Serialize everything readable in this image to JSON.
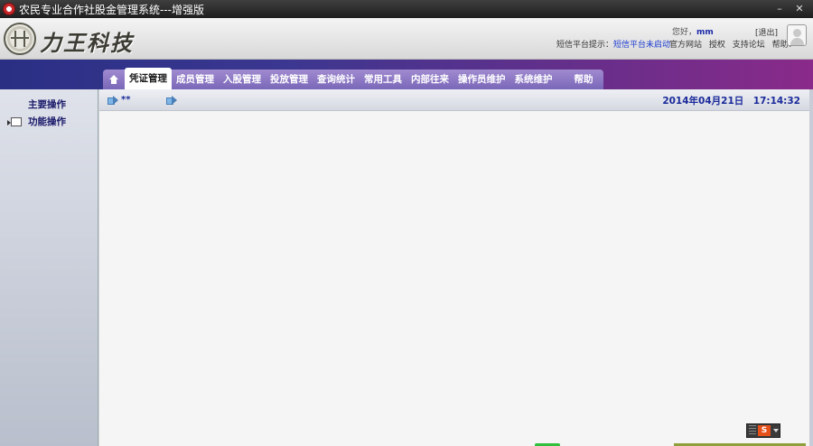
{
  "window": {
    "title": "农民专业合作社股金管理系统---增强版",
    "controls": {
      "minimize": "–",
      "close": "✕"
    }
  },
  "header": {
    "brand": "力王科技",
    "greeting_prefix": "您好，",
    "username": "mm",
    "logout": "[退出]",
    "sms_label": "短信平台提示：",
    "sms_status": "短信平台未启动",
    "links": [
      "官方网站",
      "授权",
      "支持论坛",
      "帮助?"
    ]
  },
  "nav": {
    "home_icon": "home-icon",
    "items": [
      {
        "label": "凭证管理",
        "active": true
      },
      {
        "label": "成员管理"
      },
      {
        "label": "入股管理"
      },
      {
        "label": "投放管理"
      },
      {
        "label": "查询统计"
      },
      {
        "label": "常用工具"
      },
      {
        "label": "内部往来"
      },
      {
        "label": "操作员维护"
      },
      {
        "label": "系统维护"
      },
      {
        "label": "帮助"
      }
    ]
  },
  "sidebar": {
    "items": [
      "主要操作",
      "功能操作"
    ]
  },
  "content": {
    "breadcrumb": "**",
    "datetime": "2014年04月21日　17:14:32"
  },
  "ime": {
    "label": "S"
  },
  "colors": {
    "nav_band_start": "#2a2f84",
    "nav_band_end": "#8a2a8a",
    "link_blue": "#1a2a9a"
  }
}
